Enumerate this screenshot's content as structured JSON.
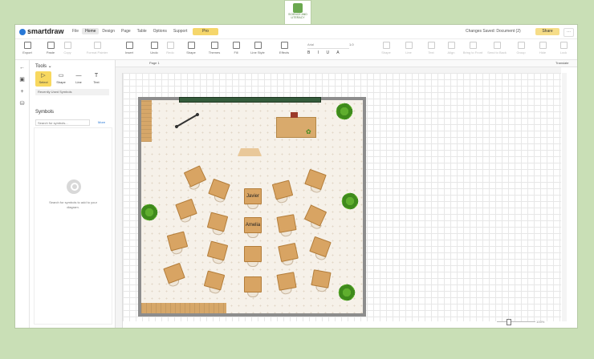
{
  "logo": {
    "text_line1": "SCIENCE AND",
    "text_line2": "LITERACY"
  },
  "app": {
    "brand": "smartdraw",
    "menu": [
      "File",
      "Home",
      "Design",
      "Page",
      "Table",
      "Options",
      "Support"
    ],
    "menu_active": "Home",
    "pro_label": "Pro",
    "status": "Changes Saved: Document (2)",
    "share_label": "Share"
  },
  "ribbon": {
    "buttons": [
      "Export",
      "Paste",
      "Copy",
      "Format Painter",
      "Insert",
      "Undo",
      "Redo",
      "Shape",
      "Themes",
      "Fill",
      "Line Style",
      "Effects"
    ],
    "font_placeholder": "Arial",
    "font_size": "1.0",
    "right_buttons": [
      "Shape",
      "Line",
      "Text",
      "Align",
      "Bring to Front",
      "Send to Back",
      "Group",
      "Hide",
      "Lock"
    ]
  },
  "panel": {
    "tools_header": "Tools",
    "tools": [
      {
        "label": "Select",
        "glyph": "▷"
      },
      {
        "label": "Shape",
        "glyph": "▭"
      },
      {
        "label": "Line",
        "glyph": "—"
      },
      {
        "label": "Text",
        "glyph": "T"
      }
    ],
    "recent": "Recently Used Symbols",
    "symbols_header": "Symbols",
    "search_placeholder": "Search for symbols...",
    "more_label": "More",
    "empty_text": "Search for symbols to add to your diagram."
  },
  "doc": {
    "page_label": "Page 1",
    "translate_label": "Translate",
    "zoom_label": "100%"
  },
  "desks": [
    {
      "name": "",
      "rot": -25
    },
    {
      "name": "",
      "rot": 20
    },
    {
      "name": "Javier",
      "rot": 0
    },
    {
      "name": "",
      "rot": -15
    },
    {
      "name": "",
      "rot": 20
    },
    {
      "name": "",
      "rot": -20
    },
    {
      "name": "",
      "rot": 15
    },
    {
      "name": "Amelia",
      "rot": 0
    },
    {
      "name": "",
      "rot": -10
    },
    {
      "name": "",
      "rot": 25
    },
    {
      "name": "",
      "rot": -15
    },
    {
      "name": "",
      "rot": 15
    },
    {
      "name": "",
      "rot": 0
    },
    {
      "name": "",
      "rot": -12
    },
    {
      "name": "",
      "rot": 20
    },
    {
      "name": "",
      "rot": -20
    },
    {
      "name": "",
      "rot": 15
    },
    {
      "name": "",
      "rot": 0
    },
    {
      "name": "",
      "rot": -10
    },
    {
      "name": "",
      "rot": 10
    }
  ]
}
